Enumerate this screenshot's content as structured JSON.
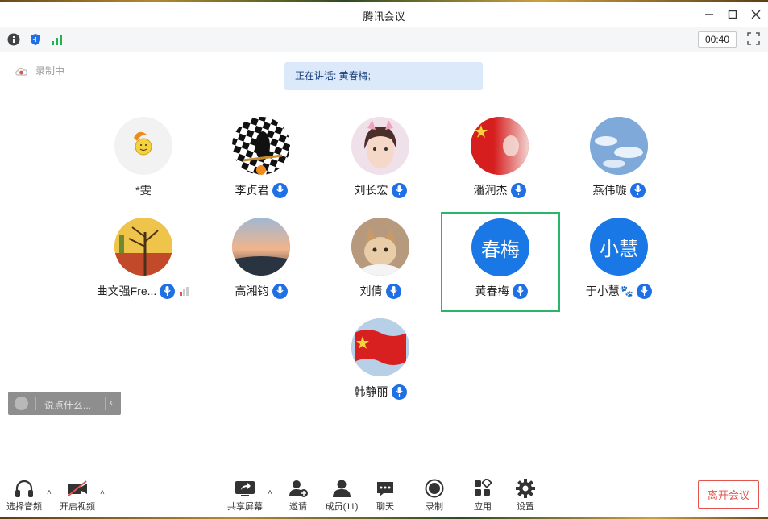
{
  "window": {
    "title": "腾讯会议"
  },
  "toolbar": {
    "timer": "00:40"
  },
  "recording": {
    "label": "录制中"
  },
  "speaking": {
    "text": "正在讲话: 黄春梅;"
  },
  "participants": [
    {
      "name": "*雯"
    },
    {
      "name": "李贞君"
    },
    {
      "name": "刘长宏"
    },
    {
      "name": "潘润杰"
    },
    {
      "name": "燕伟璇"
    },
    {
      "name": "曲文强Fre..."
    },
    {
      "name": "高湘钧"
    },
    {
      "name": "刘倩"
    },
    {
      "name": "黄春梅",
      "avatar_text": "春梅"
    },
    {
      "name": "于小慧🐾",
      "avatar_text": "小慧"
    },
    {
      "name": "韩静丽"
    }
  ],
  "chat": {
    "placeholder": "说点什么..."
  },
  "bottom": {
    "audio": "选择音频",
    "video": "开启视频",
    "share": "共享屏幕",
    "invite": "邀请",
    "members": "成员(11)",
    "chat": "聊天",
    "record": "录制",
    "apps": "应用",
    "settings": "设置",
    "leave": "离开会议"
  },
  "colors": {
    "accent": "#1a78e6",
    "active_border": "#2bb56a",
    "leave": "#e4534e"
  }
}
